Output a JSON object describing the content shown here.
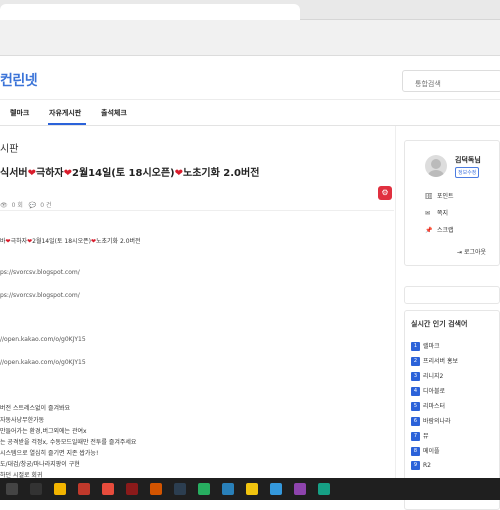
{
  "site": {
    "logo": "컨린넷",
    "search_placeholder": "통합검색"
  },
  "nav": [
    {
      "label": "렐마크"
    },
    {
      "label": "자유게시판"
    },
    {
      "label": "출석체크"
    }
  ],
  "board": {
    "title": "시판"
  },
  "post": {
    "title_prefix": "식서버",
    "title_mid1": "극하자",
    "title_mid2": "2월14일(토 18시오픈)",
    "title_end": "노초기화 2.0버전",
    "views": "0 회",
    "comments": "0 건",
    "body": [
      "바",
      "극하자",
      "2월14일(토 18시오픈)",
      "노초기화 2.0버전",
      "ps://svorcsv.blogspot.com/",
      "ps://svorcsv.blogspot.com/",
      "//open.kakao.com/o/g0KJY15",
      "//open.kakao.com/o/g0KJY15",
      "버전 스트레스없이 즐겨봐요",
      "자동사냥무한가동",
      "만들어가는 환경,버그외에는 관여x",
      "는 공격받을 걱정x, 수동모드일때만 전투를 즐겨주세요",
      "시스템으로 열심히 즐기면 지존 쌉가능!",
      "도/대검/창궁/마나라지팡이 구현",
      "하던 시절로 회귀"
    ]
  },
  "user": {
    "name": "김덕독님",
    "badge": "정보수정",
    "menu": [
      {
        "icon": "point-icon",
        "label": "포인트"
      },
      {
        "icon": "mail-icon",
        "label": "쪽지"
      },
      {
        "icon": "pin-icon",
        "label": "스크랩"
      }
    ],
    "logout": "로그아웃"
  },
  "popular": {
    "title": "실시간 인기 검색어",
    "items": [
      {
        "rank": "1",
        "label": "렐마크"
      },
      {
        "rank": "2",
        "label": "프리서버 홍보"
      },
      {
        "rank": "3",
        "label": "리니지2"
      },
      {
        "rank": "4",
        "label": "디아블로"
      },
      {
        "rank": "5",
        "label": "리마스터"
      },
      {
        "rank": "6",
        "label": "바람의나라"
      },
      {
        "rank": "7",
        "label": "뮤"
      },
      {
        "rank": "8",
        "label": "메이플"
      },
      {
        "rank": "9",
        "label": "R2"
      }
    ]
  },
  "colors": {
    "accent": "#2b62d9",
    "heart": "#d91b2b",
    "danger": "#e0303f"
  }
}
